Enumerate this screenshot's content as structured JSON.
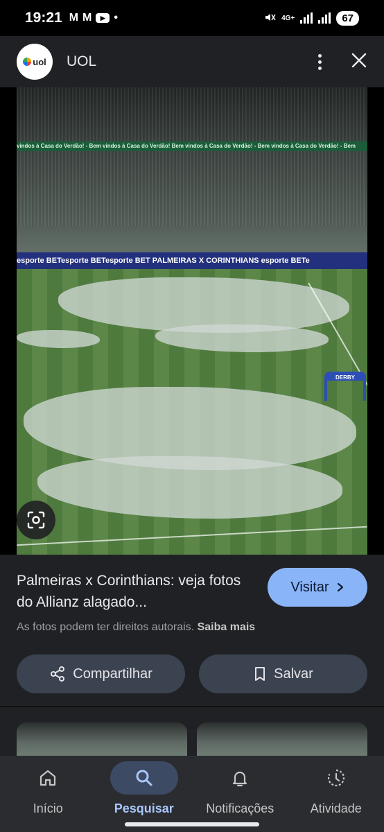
{
  "status_bar": {
    "time": "19:21",
    "battery": "67",
    "network": "4G+",
    "left_icons": [
      "gmail-icon",
      "gmail-icon",
      "youtube-icon",
      "dot-icon"
    ]
  },
  "header": {
    "app_name": "UOL",
    "logo_text": "uol"
  },
  "image": {
    "banner_text": "vindos à Casa do Verdão! - Bem vindos à Casa do Verdão!  Bem vindos à Casa do Verdão! - Bem vindos à Casa do Verdão! - Bem",
    "ad_text": "esporte   BETesporte   BETesporte   BET   PALMEIRAS X CORINTHIANS   esporte   BETe",
    "derby_text": "DERBY"
  },
  "result": {
    "title": "Palmeiras x Corinthians: veja fotos do Allianz alagado...",
    "visit_label": "Visitar",
    "rights_text": "As fotos podem ter direitos autorais.",
    "learn_more": "Saiba mais",
    "share_label": "Compartilhar",
    "save_label": "Salvar"
  },
  "nav": {
    "items": [
      {
        "label": "Início",
        "icon": "home-icon"
      },
      {
        "label": "Pesquisar",
        "icon": "search-icon"
      },
      {
        "label": "Notificações",
        "icon": "bell-icon"
      },
      {
        "label": "Atividade",
        "icon": "activity-icon"
      }
    ]
  },
  "colors": {
    "accent": "#8ab4f8",
    "surface": "#202124",
    "button": "#3c4350",
    "active_nav": "#a8c7fa"
  }
}
